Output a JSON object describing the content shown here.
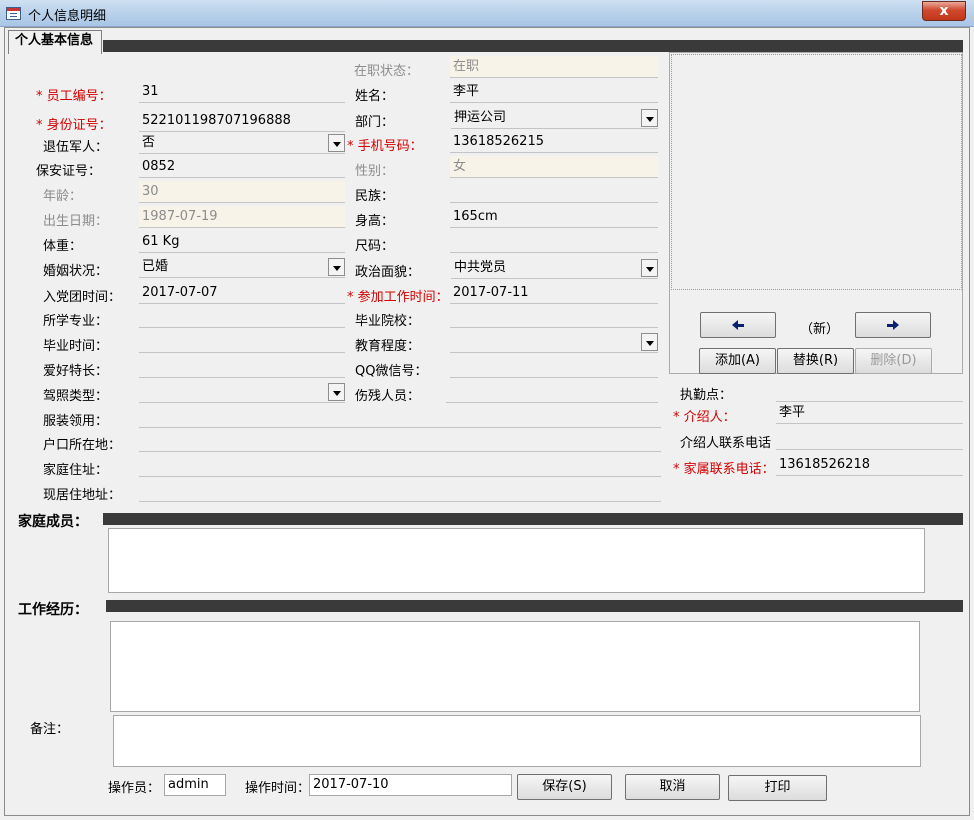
{
  "window": {
    "title": "个人信息明细",
    "close_glyph": "x"
  },
  "tab": "个人基本信息",
  "left": [
    {
      "label": "* 员工编号：",
      "value": "31",
      "required": true
    },
    {
      "label": "* 身份证号：",
      "value": "522101198707196888",
      "required": true
    },
    {
      "label": "退伍军人：",
      "value": "否",
      "combo": true
    },
    {
      "label": "保安证号：",
      "value": "0852"
    },
    {
      "label": "年龄：",
      "value": "30",
      "disabled": true
    },
    {
      "label": "出生日期：",
      "value": "1987-07-19",
      "disabled": true
    },
    {
      "label": "体重：",
      "value": "61 Kg"
    },
    {
      "label": "婚姻状况：",
      "value": "已婚",
      "combo": true
    },
    {
      "label": "入党团时间：",
      "value": "2017-07-07"
    },
    {
      "label": "所学专业：",
      "value": ""
    },
    {
      "label": "毕业时间：",
      "value": ""
    },
    {
      "label": "爱好特长：",
      "value": ""
    },
    {
      "label": "驾照类型：",
      "value": "",
      "combo": true
    }
  ],
  "wide": [
    {
      "label": "服装领用：",
      "value": ""
    },
    {
      "label": "户口所在地：",
      "value": ""
    },
    {
      "label": "家庭住址：",
      "value": ""
    },
    {
      "label": "现居住地址：",
      "value": ""
    }
  ],
  "middle": [
    {
      "label": "在职状态：",
      "value": "在职",
      "disabled": true
    },
    {
      "label": "姓名：",
      "value": "李平"
    },
    {
      "label": "部门：",
      "value": "押运公司",
      "combo": true
    },
    {
      "label": "* 手机号码：",
      "value": "13618526215",
      "required": true
    },
    {
      "label": "性别：",
      "value": "女",
      "disabled": true
    },
    {
      "label": "民族：",
      "value": ""
    },
    {
      "label": "身高：",
      "value": "165cm"
    },
    {
      "label": "尺码：",
      "value": ""
    },
    {
      "label": "政治面貌：",
      "value": "中共党员",
      "combo": true
    },
    {
      "label": "* 参加工作时间：",
      "value": "2017-07-11",
      "required": true
    },
    {
      "label": "毕业院校：",
      "value": ""
    },
    {
      "label": "教育程度：",
      "value": "",
      "combo": true
    },
    {
      "label": "QQ微信号：",
      "value": ""
    },
    {
      "label": "伤残人员：",
      "value": ""
    }
  ],
  "photo": {
    "prev_icon": "arrow-left-icon",
    "next_icon": "arrow-right-icon",
    "status": "（新）",
    "add": "添加(A)",
    "replace": "替换(R)",
    "delete": "删除(D)"
  },
  "right": [
    {
      "label": "执勤点：",
      "value": ""
    },
    {
      "label": "* 介绍人：",
      "value": "李平",
      "required": true
    },
    {
      "label": "介绍人联系电话",
      "value": ""
    },
    {
      "label": "* 家属联系电话：",
      "value": "13618526218",
      "required": true
    }
  ],
  "sections": {
    "family": "家庭成员：",
    "work": "工作经历：",
    "remarks": "备注："
  },
  "footer": {
    "operator_label": "操作员：",
    "operator_value": "admin",
    "time_label": "操作时间：",
    "time_value": "2017-07-10",
    "save": "保存(S)",
    "cancel": "取消",
    "print": "打印"
  },
  "colors": {
    "required": "#d40000",
    "bar": "#3a3a3a",
    "title_gradient_top": "#cfe0f3"
  }
}
